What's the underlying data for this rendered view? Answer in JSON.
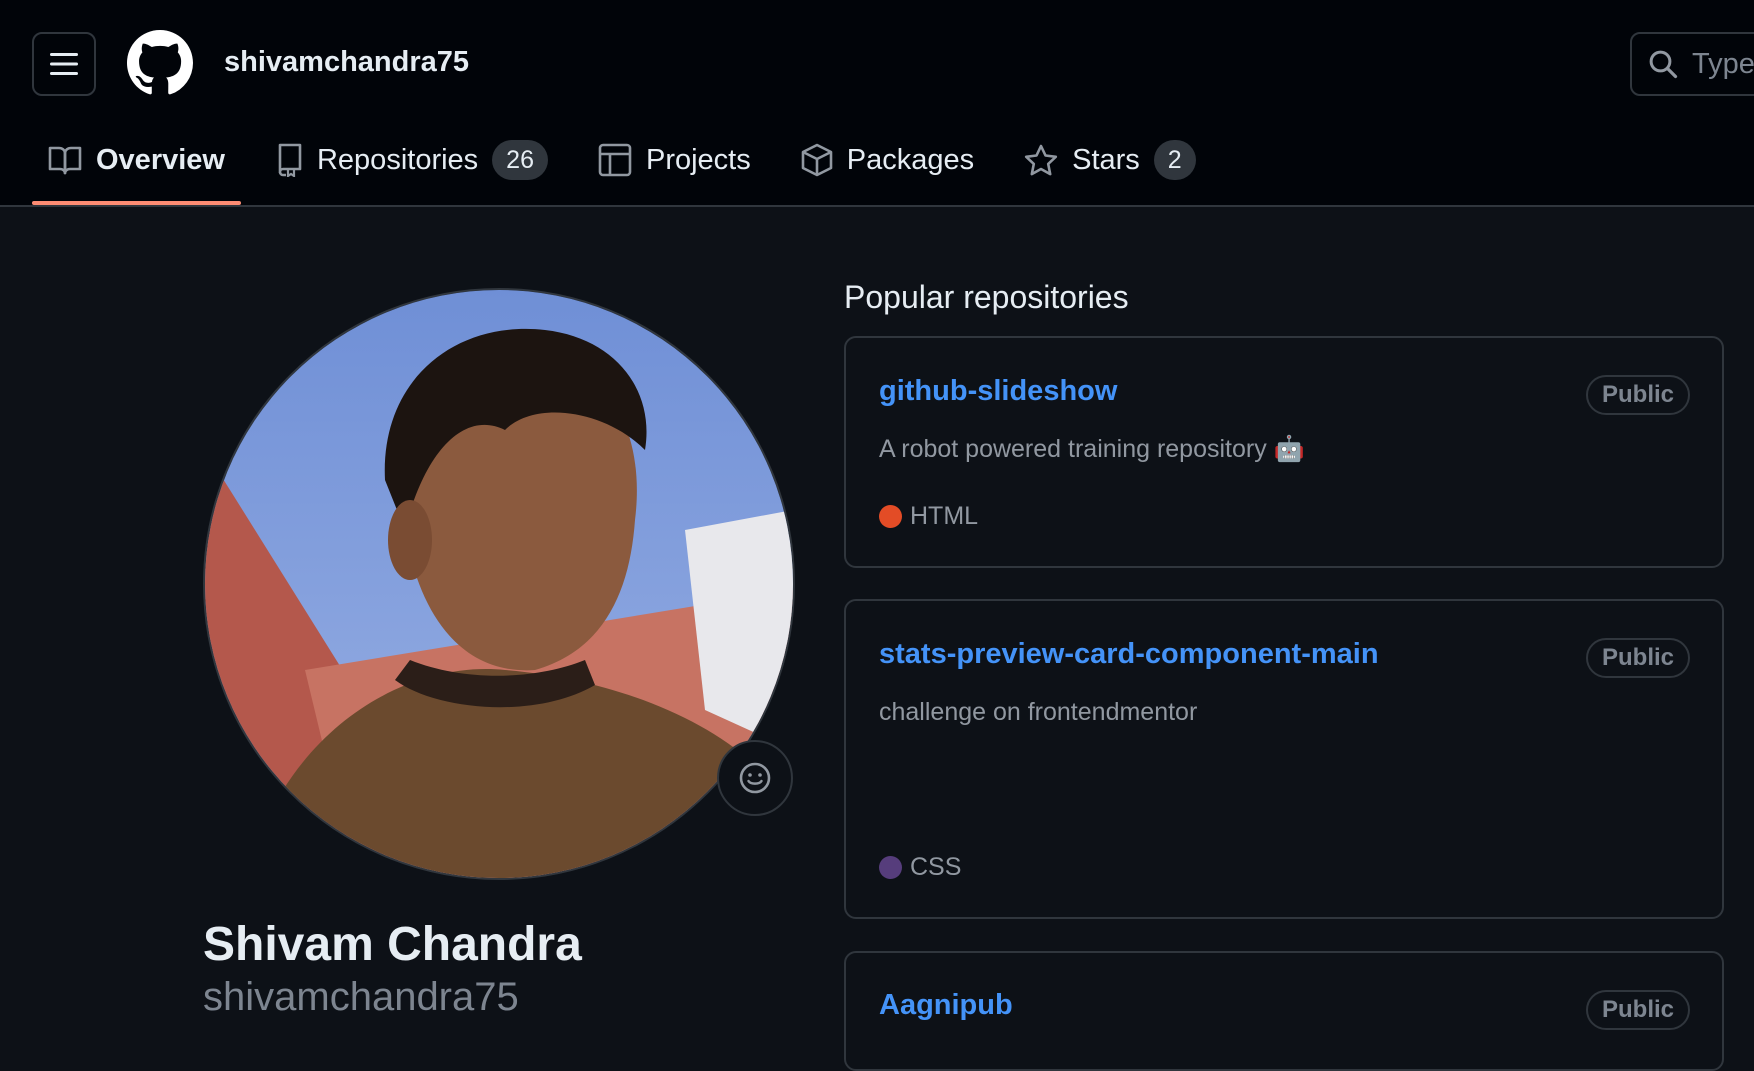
{
  "header": {
    "username": "shivamchandra75",
    "search_placeholder": "Type"
  },
  "tabs": [
    {
      "label": "Overview",
      "icon": "book-icon",
      "selected": true
    },
    {
      "label": "Repositories",
      "icon": "repo-icon",
      "count": "26"
    },
    {
      "label": "Projects",
      "icon": "table-icon"
    },
    {
      "label": "Packages",
      "icon": "package-icon"
    },
    {
      "label": "Stars",
      "icon": "star-icon",
      "count": "2"
    }
  ],
  "profile": {
    "name": "Shivam Chandra",
    "login": "shivamchandra75"
  },
  "popular": {
    "title": "Popular repositories",
    "repos": [
      {
        "name": "github-slideshow",
        "visibility": "Public",
        "description": "A robot powered training repository 🤖",
        "language": "HTML",
        "language_color": "#e34c26"
      },
      {
        "name": "stats-preview-card-component-main",
        "visibility": "Public",
        "description": "challenge on frontendmentor",
        "language": "CSS",
        "language_color": "#563d7c"
      },
      {
        "name": "Aagnipub",
        "visibility": "Public"
      }
    ]
  },
  "colors": {
    "background": "#0d1117",
    "header_bg": "#010409",
    "border": "#30363d",
    "link": "#4493f8",
    "tab_underline": "#fd8c73"
  }
}
